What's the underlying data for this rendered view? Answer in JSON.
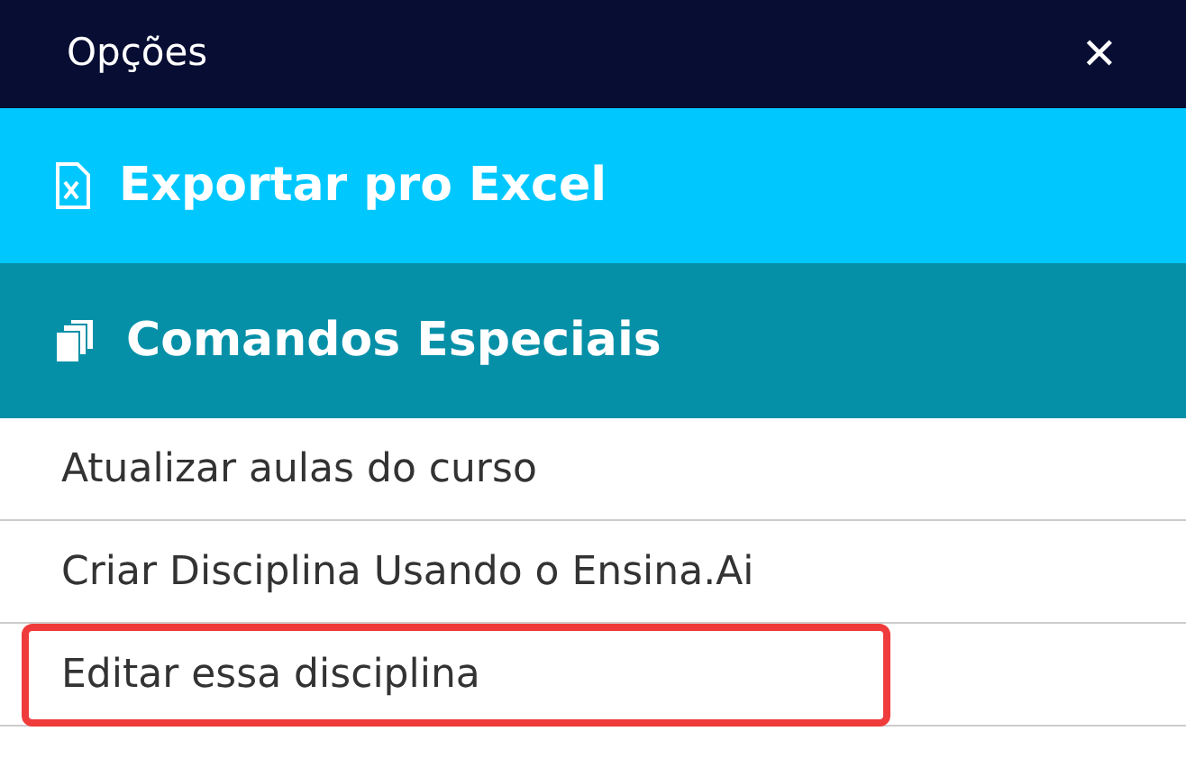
{
  "header": {
    "title": "Opções",
    "close": "✕"
  },
  "sections": [
    {
      "kind": "excel",
      "label": "Exportar pro Excel"
    },
    {
      "kind": "commands",
      "label": "Comandos Especiais"
    }
  ],
  "items": [
    {
      "label": "Atualizar aulas do curso",
      "highlighted": false
    },
    {
      "label": "Criar Disciplina Usando o Ensina.Ai",
      "highlighted": false
    },
    {
      "label": "Editar essa disciplina",
      "highlighted": true
    }
  ]
}
